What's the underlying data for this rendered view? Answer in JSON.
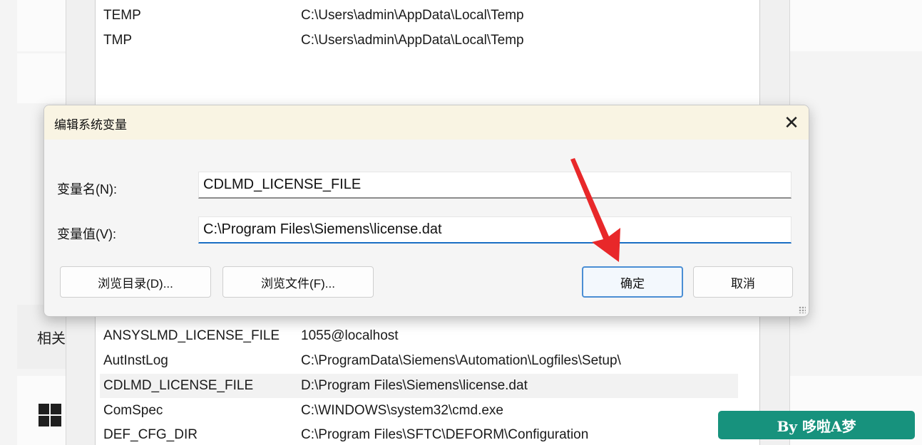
{
  "background": {
    "related_label": "相关",
    "env_rows_top": [
      {
        "name": "TEMP",
        "value": "C:\\Users\\admin\\AppData\\Local\\Temp"
      },
      {
        "name": "TMP",
        "value": "C:\\Users\\admin\\AppData\\Local\\Temp"
      }
    ],
    "env_rows_bottom": [
      {
        "name": "ANSYSLMD_LICENSE_FILE",
        "value": "1055@localhost"
      },
      {
        "name": "AutInstLog",
        "value": "C:\\ProgramData\\Siemens\\Automation\\Logfiles\\Setup\\"
      },
      {
        "name": "CDLMD_LICENSE_FILE",
        "value": "D:\\Program Files\\Siemens\\license.dat"
      },
      {
        "name": "ComSpec",
        "value": "C:\\WINDOWS\\system32\\cmd.exe"
      },
      {
        "name": "DEF_CFG_DIR",
        "value": "C:\\Program Files\\SFTC\\DEFORM\\Configuration"
      }
    ],
    "selected_row": "CDLMD_LICENSE_FILE",
    "start_icon": "windows-start-icon"
  },
  "dialog": {
    "title": "编辑系统变量",
    "close_icon": "close-icon",
    "name_label": "变量名(N):",
    "name_value": "CDLMD_LICENSE_FILE",
    "value_label": "变量值(V):",
    "value_value": "C:\\Program Files\\Siemens\\license.dat",
    "browse_dir_label": "浏览目录(D)...",
    "browse_file_label": "浏览文件(F)...",
    "ok_label": "确定",
    "cancel_label": "取消"
  },
  "annotation": {
    "arrow_color": "#e8282a",
    "arrow_icon": "red-arrow-pointer"
  },
  "watermark": {
    "text": "By 哆啦A梦",
    "color": "#17927d"
  }
}
